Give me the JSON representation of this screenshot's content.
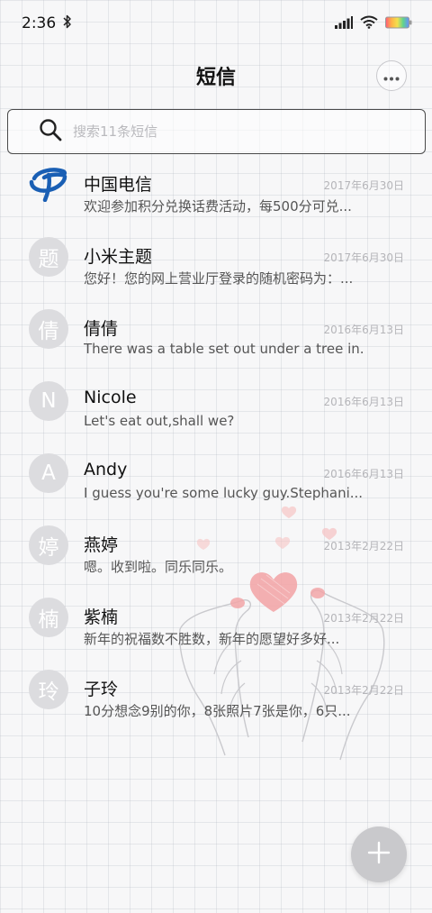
{
  "status": {
    "time": "2:36",
    "bluetooth_icon": "bluetooth-icon",
    "signal_icon": "signal-bars-icon",
    "wifi_icon": "wifi-icon",
    "battery_icon": "battery-icon"
  },
  "header": {
    "title": "短信",
    "more_icon": "more-horizontal-icon"
  },
  "search": {
    "placeholder": "搜索11条短信",
    "icon": "search-icon"
  },
  "colors": {
    "accent_logo": "#1a5fb4",
    "avatar_gray": "#dcdcdf",
    "fab_gray": "#c9c9cc",
    "heart": "#f2a6a8"
  },
  "conversations": [
    {
      "avatar": "",
      "name": "中国电信",
      "date": "2017年6月30日",
      "preview": "欢迎参加积分兑换话费活动，每500分可兑..."
    },
    {
      "avatar": "题",
      "name": "小米主题",
      "date": "2017年6月30日",
      "preview": "您好！您的网上营业厅登录的随机密码为：..."
    },
    {
      "avatar": "倩",
      "name": "倩倩",
      "date": "2016年6月13日",
      "preview": "There was a table set out under a tree in..."
    },
    {
      "avatar": "N",
      "name": "Nicole",
      "date": "2016年6月13日",
      "preview": "Let's eat out,shall we?"
    },
    {
      "avatar": "A",
      "name": "Andy",
      "date": "2016年6月13日",
      "preview": "I guess you're some lucky guy.Stephani..."
    },
    {
      "avatar": "婷",
      "name": "燕婷",
      "date": "2013年2月22日",
      "preview": "嗯。收到啦。同乐同乐。"
    },
    {
      "avatar": "楠",
      "name": "紫楠",
      "date": "2013年2月22日",
      "preview": "新年的祝福数不胜数，新年的愿望好多好..."
    },
    {
      "avatar": "玲",
      "name": "子玲",
      "date": "2013年2月22日",
      "preview": "10分想念9别的你，8张照片7张是你，6只..."
    }
  ],
  "fab": {
    "icon": "plus-icon"
  }
}
